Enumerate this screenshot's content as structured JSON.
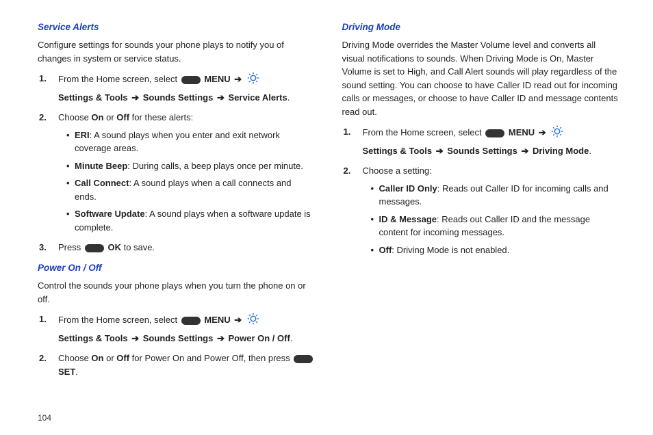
{
  "pageNumber": "104",
  "leftCol": {
    "section1": {
      "heading": "Service Alerts",
      "intro": "Configure settings for sounds your phone plays to notify you of changes in system or service status.",
      "step1_a": "From the Home screen, select ",
      "step1_menu": "MENU",
      "step1_b": "Settings & Tools",
      "step1_c": "Sounds Settings",
      "step1_d": "Service Alerts",
      "step2_a": "Choose ",
      "step2_on": "On",
      "step2_or": " or ",
      "step2_off": "Off",
      "step2_b": " for these alerts:",
      "bullets": [
        {
          "b": "ERI",
          "t": ": A sound plays when you enter and exit network coverage areas."
        },
        {
          "b": "Minute Beep",
          "t": ": During calls, a beep plays once per minute."
        },
        {
          "b": "Call Connect",
          "t": ": A sound plays when a call connects and ends."
        },
        {
          "b": "Software Update",
          "t": ": A sound plays when a software update is complete."
        }
      ],
      "step3_a": "Press ",
      "step3_ok": "OK",
      "step3_b": " to save."
    },
    "section2": {
      "heading": "Power On / Off",
      "intro": "Control the sounds your phone plays when you turn the phone on or off.",
      "step1_a": "From the Home screen, select ",
      "step1_menu": "MENU",
      "step1_b": "Settings & Tools",
      "step1_c": "Sounds Settings",
      "step1_d": "Power On / Off",
      "step2_a": "Choose ",
      "step2_on": "On",
      "step2_or": " or ",
      "step2_off": "Off",
      "step2_b": " for Power On and Power Off, then press ",
      "step2_set": "SET",
      "step2_c": "."
    }
  },
  "rightCol": {
    "section1": {
      "heading": "Driving Mode",
      "intro": "Driving Mode overrides the Master Volume level and converts all visual notifications to sounds. When Driving Mode is On, Master Volume is set to High, and Call Alert sounds will play regardless of the sound setting. You can choose to have Caller ID read out for incoming calls or messages, or choose to have Caller ID and message contents read out.",
      "step1_a": "From the Home screen, select ",
      "step1_menu": "MENU",
      "step1_b": "Settings & Tools",
      "step1_c": "Sounds Settings",
      "step1_d": "Driving Mode",
      "step2_a": "Choose a setting:",
      "bullets": [
        {
          "b": "Caller ID Only",
          "t": ": Reads out Caller ID  for incoming calls and messages."
        },
        {
          "b": "ID & Message",
          "t": ": Reads out Caller ID and the message content for incoming messages."
        },
        {
          "b": "Off",
          "t": ": Driving Mode is not enabled."
        }
      ]
    }
  }
}
